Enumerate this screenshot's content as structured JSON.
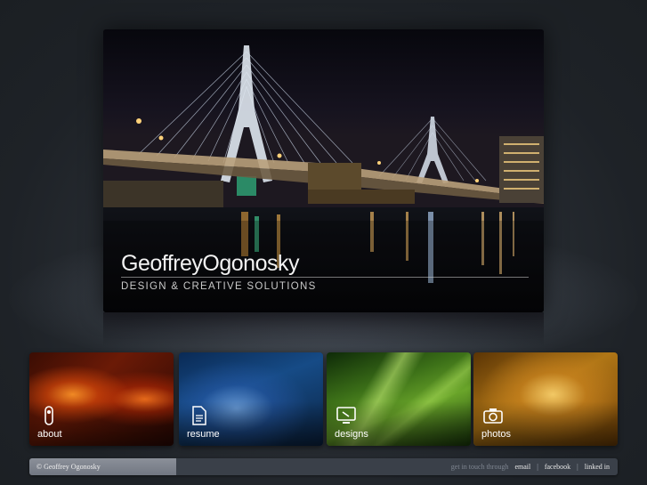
{
  "hero": {
    "brand_name": "GeoffreyOgonosky",
    "tagline": "DESIGN & CREATIVE SOLUTIONS"
  },
  "tiles": [
    {
      "label": "about",
      "icon": "person-icon"
    },
    {
      "label": "resume",
      "icon": "document-icon"
    },
    {
      "label": "designs",
      "icon": "monitor-icon"
    },
    {
      "label": "photos",
      "icon": "camera-icon"
    }
  ],
  "footer": {
    "copyright": "© Geoffrey Ogonosky",
    "contact_prompt": "get in touch through",
    "links": [
      "email",
      "facebook",
      "linked in"
    ],
    "separator": "|"
  },
  "colors": {
    "background": "#1e2227",
    "footer_bar": "#3a4049",
    "footer_left": "#7d828c"
  }
}
